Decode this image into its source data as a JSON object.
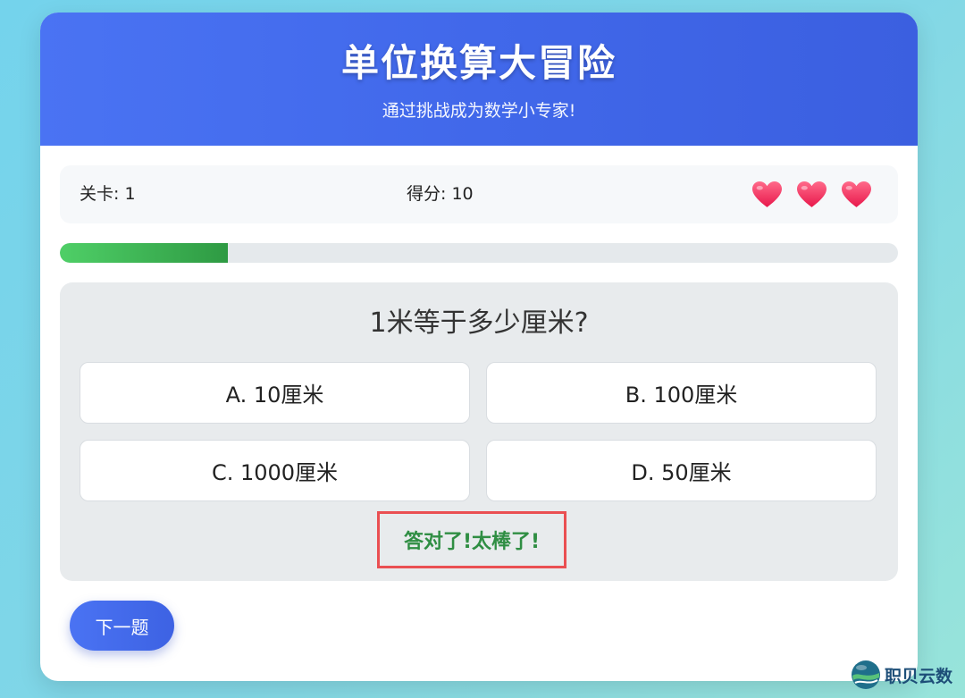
{
  "header": {
    "title": "单位换算大冒险",
    "subtitle": "通过挑战成为数学小专家!"
  },
  "stats": {
    "level": "关卡: 1",
    "score": "得分: 10",
    "lives": 3
  },
  "progress": {
    "fraction": 0.2
  },
  "question": {
    "text": "1米等于多少厘米?",
    "options": [
      {
        "label": "A. 10厘米"
      },
      {
        "label": "B. 100厘米"
      },
      {
        "label": "C. 1000厘米"
      },
      {
        "label": "D. 50厘米"
      }
    ],
    "feedback": "答对了!太棒了!"
  },
  "next_button": {
    "label": "下一题"
  },
  "watermark": {
    "text": "职贝云数"
  },
  "colors": {
    "accent": "#4a73f3",
    "success": "#2f8e43",
    "highlight": "#ea4f52",
    "heart": "#f02a5c"
  },
  "icons": {
    "life": "heart-icon",
    "watermark": "globe-logo-icon"
  }
}
